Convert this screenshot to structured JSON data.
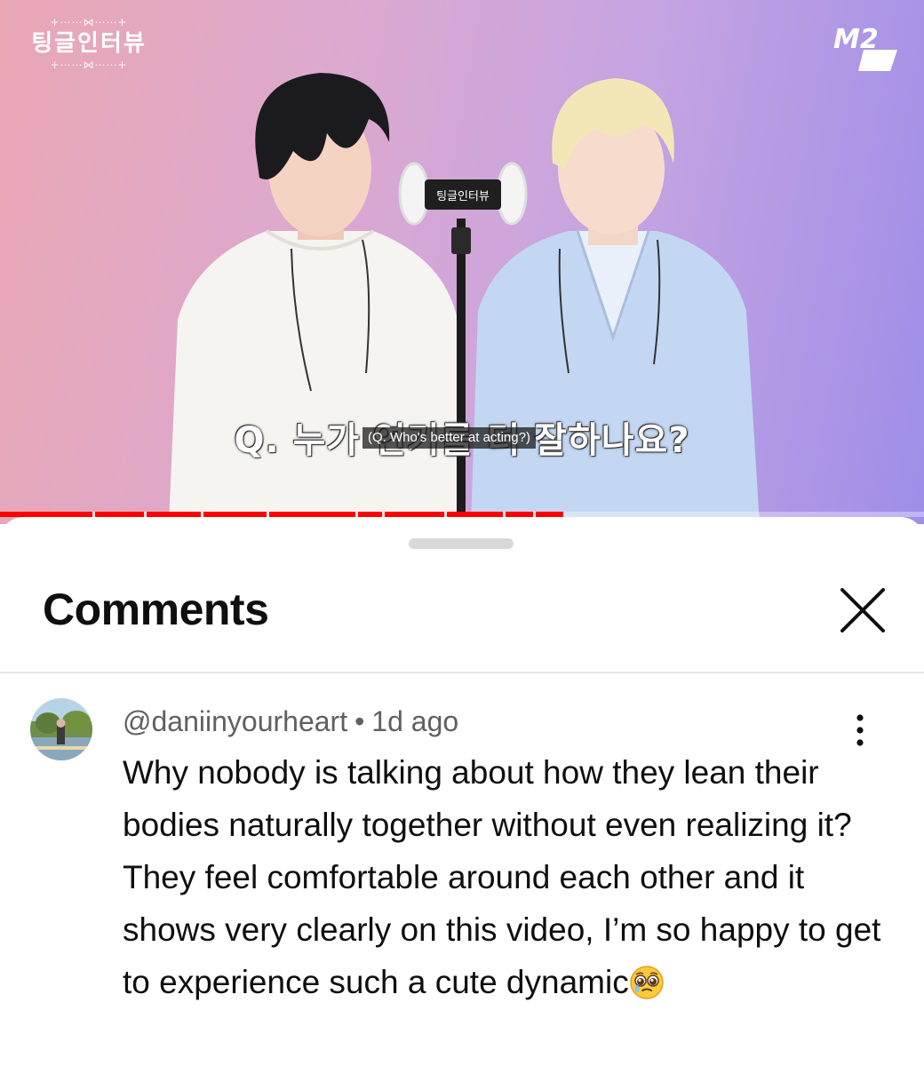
{
  "video": {
    "channel_logo_text": "팅글인터뷰",
    "channel_logo_ornament": "+⋯⋯⋈⋯⋯+",
    "network_logo": "M2",
    "subtitle_korean": "Q. 누가 연기를 더 잘하나요?",
    "subtitle_english": "(Q. Who's better at acting?)",
    "mic_label": "팅글인터뷰",
    "progress": 0.61,
    "colors": {
      "progress": "#ff0000"
    }
  },
  "comments_sheet": {
    "title": "Comments",
    "close_icon": "close-icon"
  },
  "comment": {
    "author": "@daniinyourheart",
    "separator": "•",
    "time": "1d ago",
    "text": "Why nobody is talking about how they lean their bodies naturally together without even realizing it? They feel comfortable around each other and it shows very clearly on this video, I’m so happy to get to experience such a cute dynamic",
    "emoji": "🥹",
    "menu_icon": "more-vert-icon"
  }
}
